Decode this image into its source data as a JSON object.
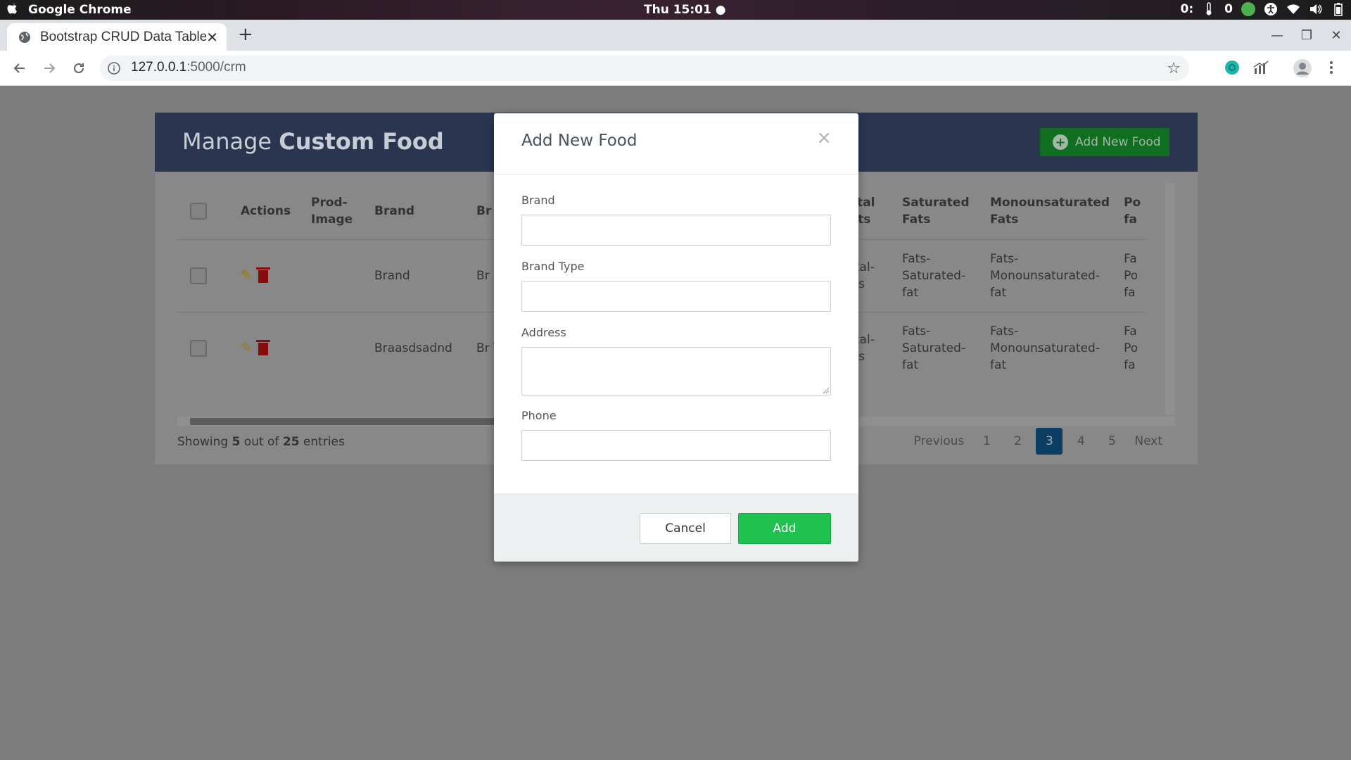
{
  "os_bar": {
    "app_name": "Google Chrome",
    "clock": "Thu 15:01 ●",
    "tray_counter_a": "0:",
    "tray_counter_b": "0"
  },
  "browser": {
    "tab_title": "Bootstrap CRUD Data Table",
    "url_host": "127.0.0.1",
    "url_rest": ":5000/crm"
  },
  "page": {
    "title_light": "Manage ",
    "title_bold": "Custom Food",
    "add_button_label": "Add New Food",
    "table": {
      "headers": {
        "actions": "Actions",
        "prod_image": "Prod-Image",
        "brand": "Brand",
        "brand_type_partial": "Br",
        "total_fats": "Total Fats",
        "saturated_fats": "Saturated Fats",
        "monounsaturated_fats": "Monounsaturated Fats",
        "polyunsaturated_partial": "Po fa"
      },
      "rows": [
        {
          "brand": "Brand",
          "brand_type_partial": "Br",
          "total_fats": "Total-fats",
          "saturated_fats": "Fats-Saturated-fat",
          "monounsaturated_fats": "Fats-Monounsaturated-fat",
          "polyunsaturated_partial": "Fa Po fa"
        },
        {
          "brand": "Braasdsadnd",
          "brand_type_partial": "Br Ty",
          "total_fats": "Total-fats",
          "saturated_fats": "Fats-Saturated-fat",
          "monounsaturated_fats": "Fats-Monounsaturated-fat",
          "polyunsaturated_partial": "Fa Po fa"
        }
      ]
    },
    "entries": {
      "prefix": "Showing ",
      "shown": "5",
      "middle": " out of ",
      "total": "25",
      "suffix": " entries"
    },
    "pagination": {
      "previous": "Previous",
      "pages": [
        "1",
        "2",
        "3",
        "4",
        "5"
      ],
      "active_page": "3",
      "next": "Next"
    }
  },
  "modal": {
    "title": "Add New Food",
    "close_symbol": "×",
    "fields": {
      "brand_label": "Brand",
      "brand_value": "",
      "brand_type_label": "Brand Type",
      "brand_type_value": "",
      "address_label": "Address",
      "address_value": "",
      "phone_label": "Phone",
      "phone_value": ""
    },
    "cancel_label": "Cancel",
    "add_label": "Add"
  },
  "colors": {
    "header_bg": "#2a3650",
    "add_food_btn": "#0f6f1f",
    "add_btn": "#1fc24f",
    "active_page": "#0c3e63"
  }
}
